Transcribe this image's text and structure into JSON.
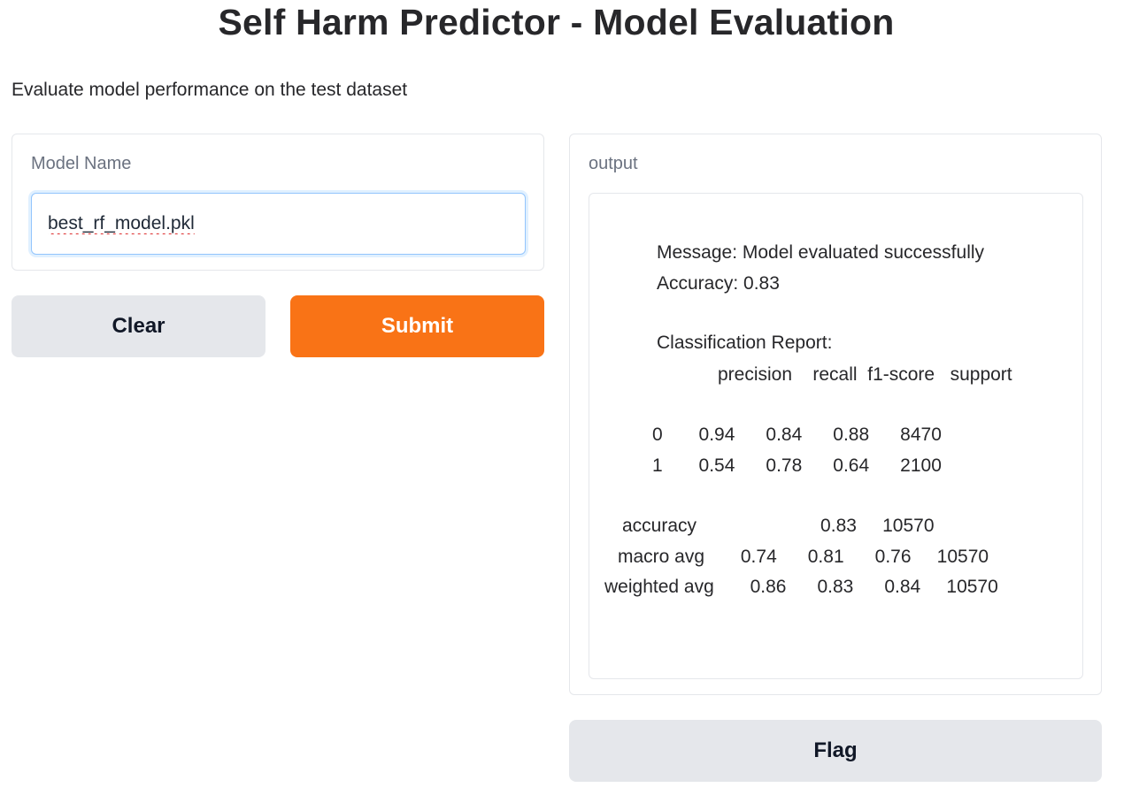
{
  "page": {
    "title": "Self Harm Predictor - Model Evaluation",
    "description": "Evaluate model performance on the test dataset"
  },
  "input": {
    "label": "Model Name",
    "value": "best_rf_model.pkl"
  },
  "buttons": {
    "clear": "Clear",
    "submit": "Submit",
    "flag": "Flag"
  },
  "output": {
    "label": "output",
    "message": "Message: Model evaluated successfully",
    "accuracy": "Accuracy: 0.83",
    "report_title": "Classification Report:",
    "report_header": "precision    recall  f1-score   support",
    "rows": [
      "0       0.94      0.84      0.88      8470",
      "1       0.54      0.78      0.64      2100",
      "accuracy                        0.83     10570",
      "macro avg       0.74      0.81      0.76     10570",
      "weighted avg       0.86      0.83      0.84     10570"
    ]
  },
  "colors": {
    "submit_bg": "#f97316",
    "secondary_bg": "#e5e7eb"
  }
}
